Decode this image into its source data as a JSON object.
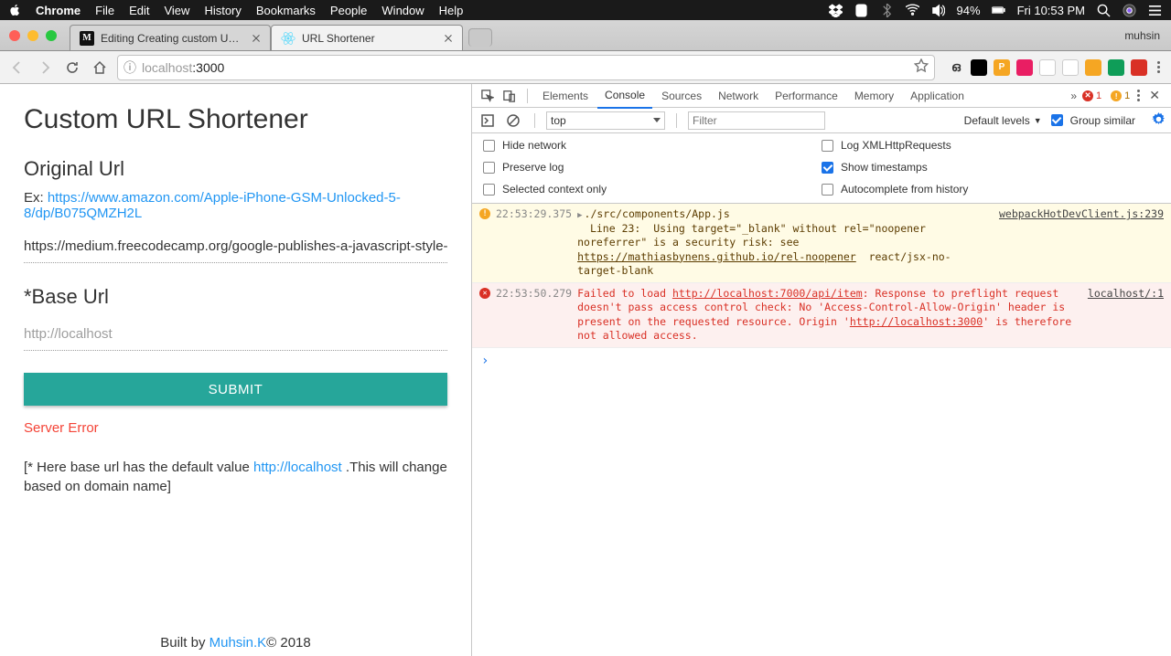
{
  "macmenu": {
    "app": "Chrome",
    "items": [
      "File",
      "Edit",
      "View",
      "History",
      "Bookmarks",
      "People",
      "Window",
      "Help"
    ],
    "battery": "94%",
    "clock": "Fri 10:53 PM"
  },
  "chrome": {
    "tabs": [
      {
        "title": "Editing Creating custom URL s",
        "active": false,
        "favicon": "medium"
      },
      {
        "title": "URL Shortener",
        "active": true,
        "favicon": "react"
      }
    ],
    "profile": "muhsin",
    "url": {
      "scheme": "ⓘ",
      "host_gray": "localhost",
      "port": ":3000"
    },
    "ext_colors": [
      "#e91e63",
      "#000",
      "#f5a623",
      "#e91e63",
      "#0f9d58",
      "#fff",
      "#f5a623",
      "#0f9d58",
      "#d93025"
    ],
    "ext_lang": "ഒ"
  },
  "app": {
    "title": "Custom URL Shortener",
    "h_orig": "Original Url",
    "ex_label": "Ex: ",
    "ex_link": "https://www.amazon.com/Apple-iPhone-GSM-Unlocked-5-8/dp/B075QMZH2L",
    "orig_value": "https://medium.freecodecamp.org/google-publishes-a-javascript-style-guid",
    "h_base": "*Base Url",
    "base_placeholder": "http://localhost",
    "submit": "SUBMIT",
    "error": "Server Error",
    "note_pre": "[* Here base url has the default value ",
    "note_link": "http://localhost",
    "note_post": " .This will change based on domain name]",
    "footer_pre": "Built by ",
    "footer_link": "Muhsin.K",
    "footer_post": "© 2018"
  },
  "devtools": {
    "tabs": [
      "Elements",
      "Console",
      "Sources",
      "Network",
      "Performance",
      "Memory",
      "Application"
    ],
    "active_tab": "Console",
    "err_count": "1",
    "warn_count": "1",
    "context": "top",
    "filter_placeholder": "Filter",
    "levels": "Default levels",
    "group_similar": "Group similar",
    "checks": {
      "hide_network": "Hide network",
      "preserve_log": "Preserve log",
      "selected_context": "Selected context only",
      "log_xhr": "Log XMLHttpRequests",
      "show_ts": "Show timestamps",
      "autocomplete": "Autocomplete from history"
    },
    "logs": [
      {
        "kind": "warn",
        "ts": "22:53:29.375",
        "src": "webpackHotDevClient.js:239",
        "msg_pre": "./src/components/App.js\n  Line 23:  Using target=\"_blank\" without rel=\"noopener noreferrer\" is a security risk: see ",
        "msg_link": "https://mathiasbynens.github.io/rel-noopener",
        "msg_post": "  react/jsx-no-target-blank"
      },
      {
        "kind": "err",
        "ts": "22:53:50.279",
        "src": "localhost/:1",
        "msg_pre": "Failed to load ",
        "msg_link1": "http://localhost:7000/api/item",
        "msg_mid": ": Response to preflight request doesn't pass access control check: No 'Access-Control-Allow-Origin' header is present on the requested resource. Origin '",
        "msg_link2": "http://localhost:3000",
        "msg_post": "' is therefore not allowed access."
      }
    ]
  }
}
